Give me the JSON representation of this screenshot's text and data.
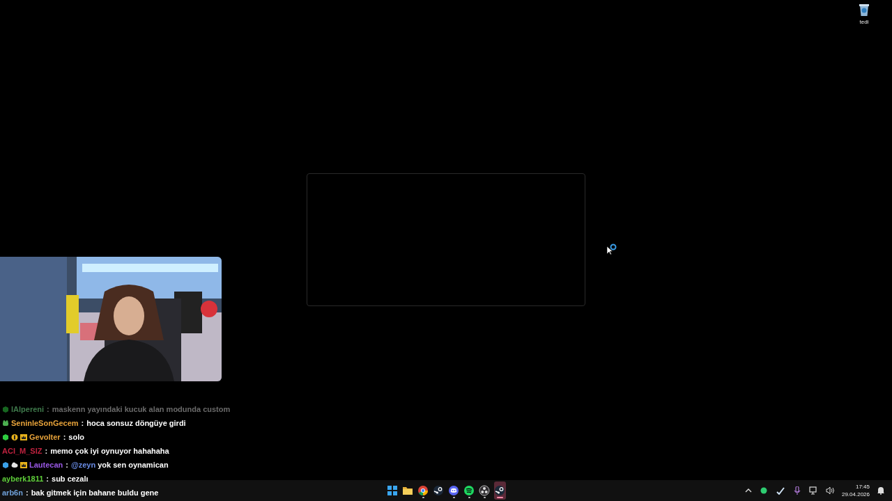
{
  "desktop_icons": [
    {
      "label": "tedi",
      "kind": "bin"
    }
  ],
  "window": {
    "kind": "empty"
  },
  "cursor": {
    "busy": true
  },
  "chat": [
    {
      "user": "lAlpereni",
      "color": "#3f7a4c",
      "faded": true,
      "badges": [
        {
          "kind": "cube"
        }
      ],
      "separator": ":",
      "text": "maskenn yayındaki kucuk alan modunda custom"
    },
    {
      "user": "SeninleSonGecem",
      "color": "#e8a33a",
      "faded": false,
      "badges": [
        {
          "kind": "creature"
        }
      ],
      "separator": ":",
      "text": "hoca sonsuz döngüye girdi"
    },
    {
      "user": "Gevolter",
      "color": "#e8a33a",
      "faded": false,
      "badges": [
        {
          "kind": "cube"
        },
        {
          "kind": "coin"
        },
        {
          "kind": "crown"
        }
      ],
      "separator": ":",
      "text": "solo"
    },
    {
      "user": "ACI_M_SIZ",
      "color": "#c0223f",
      "faded": false,
      "separator": ":",
      "text": "memo çok iyi oynuyor hahahaha"
    },
    {
      "user": "Lautecan",
      "color": "#9b59e8",
      "faded": false,
      "badges": [
        {
          "kind": "bluecube"
        },
        {
          "kind": "cloud"
        },
        {
          "kind": "crown"
        }
      ],
      "separator": ":",
      "mention": "@zeyn",
      "text": "yok sen oynamican"
    },
    {
      "user": "ayberk1811",
      "color": "#5fcf3a",
      "faded": false,
      "separator": ":",
      "text": "sub cezalı"
    },
    {
      "user": "arb6n",
      "color": "#6fa0d8",
      "faded": false,
      "separator": ":",
      "text": "bak gitmek için bahane buldu gene"
    }
  ],
  "taskbar": {
    "apps": [
      {
        "kind": "start",
        "running": false,
        "selected": false
      },
      {
        "kind": "folder",
        "running": false,
        "selected": false
      },
      {
        "kind": "chrome",
        "running": true,
        "selected": false
      },
      {
        "kind": "steam",
        "running": false,
        "selected": false
      },
      {
        "kind": "discord",
        "running": true,
        "selected": false
      },
      {
        "kind": "spotify",
        "running": true,
        "selected": false
      },
      {
        "kind": "obs",
        "running": true,
        "selected": false
      },
      {
        "kind": "steam",
        "running": true,
        "selected": true
      }
    ],
    "tray": [
      {
        "kind": "chevron"
      },
      {
        "kind": "greendot"
      },
      {
        "kind": "steam"
      },
      {
        "kind": "mic"
      },
      {
        "kind": "network"
      },
      {
        "kind": "volume"
      }
    ],
    "time": "17:45",
    "date": "29.04.2026"
  }
}
